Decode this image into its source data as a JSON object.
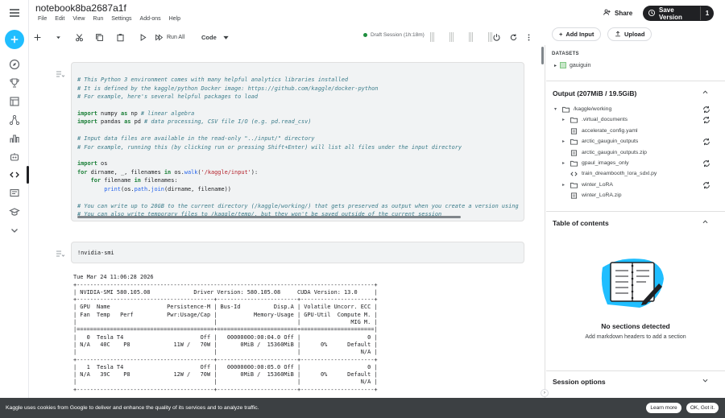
{
  "app": {
    "notebook_title": "notebook8ba2687a1f",
    "menu": [
      "File",
      "Edit",
      "View",
      "Run",
      "Settings",
      "Add-ons",
      "Help"
    ],
    "share_label": "Share",
    "save_label": "Save Version",
    "save_count": "1"
  },
  "rail": {
    "icons": [
      "menu-icon",
      "create-icon",
      "compass-icon",
      "trophy-icon",
      "table-icon",
      "models-icon",
      "chart-icon",
      "school-icon",
      "code-icon",
      "comments-icon",
      "learn-icon",
      "more-icon"
    ]
  },
  "toolbar": {
    "run_all_label": "Run All",
    "cell_type": "Code",
    "session_label": "Draft Session (1h:18m)"
  },
  "cells": {
    "code1": [
      "# This Python 3 environment comes with many helpful analytics libraries installed",
      "# It is defined by the kaggle/python Docker image: https://github.com/kaggle/docker-python",
      "# For example, here's several helpful packages to load",
      "",
      "import numpy as np # linear algebra",
      "import pandas as pd # data processing, CSV file I/O (e.g. pd.read_csv)",
      "",
      "# Input data files are available in the read-only \"../input/\" directory",
      "# For example, running this (by clicking run or pressing Shift+Enter) will list all files under the input directory",
      "",
      "import os",
      "for dirname, _, filenames in os.walk('/kaggle/input'):",
      "    for filename in filenames:",
      "        print(os.path.join(dirname, filename))",
      "",
      "# You can write up to 20GB to the current directory (/kaggle/working/) that gets preserved as output when you create a version using",
      "# You can also write temporary files to /kaggle/temp/, but they won't be saved outside of the current session"
    ],
    "code2": "!nvidia-smi",
    "output2": [
      "Tue Mar 24 11:06:28 2026",
      "+-----------------------------------------------------------------------------------------+",
      "| NVIDIA-SMI 580.105.08             Driver Version: 580.105.08     CUDA Version: 13.0     |",
      "+-----------------------------------------+------------------------+----------------------+",
      "| GPU  Name                 Persistence-M | Bus-Id          Disp.A | Volatile Uncorr. ECC |",
      "| Fan  Temp   Perf          Pwr:Usage/Cap |           Memory-Usage | GPU-Util  Compute M. |",
      "|                                         |                        |               MIG M. |",
      "|=========================================+========================+======================|",
      "|   0  Tesla T4                       Off |   00000000:00:04.0 Off |                    0 |",
      "| N/A   40C    P8             11W /   70W |       0MiB /  15360MiB |      0%      Default |",
      "|                                         |                        |                  N/A |",
      "+-----------------------------------------+------------------------+----------------------+",
      "|   1  Tesla T4                       Off |   00000000:00:05.0 Off |                    0 |",
      "| N/A   39C    P8             12W /   70W |       0MiB /  15360MiB |      0%      Default |",
      "|                                         |                        |                  N/A |",
      "+-----------------------------------------+------------------------+----------------------+"
    ]
  },
  "right_panel": {
    "add_input_label": "Add Input",
    "upload_label": "Upload",
    "datasets_label": "DATASETS",
    "dataset_name": "gauiguin",
    "output_title": "Output (207MiB / 19.5GiB)",
    "tree": [
      {
        "name": "/kaggle/working",
        "kind": "folder",
        "level": 0,
        "expanded": true,
        "sync": true
      },
      {
        "name": ".virtual_documents",
        "kind": "folder",
        "level": 1,
        "expanded": false,
        "sync": true
      },
      {
        "name": "accelerate_config.yaml",
        "kind": "file",
        "level": 1,
        "sync": false
      },
      {
        "name": "arctic_gauguin_outputs",
        "kind": "folder",
        "level": 1,
        "expanded": false,
        "sync": true
      },
      {
        "name": "arctic_gauguin_outputs.zip",
        "kind": "file",
        "level": 1,
        "sync": false
      },
      {
        "name": "gpaul_images_only",
        "kind": "folder",
        "level": 1,
        "expanded": false,
        "sync": true
      },
      {
        "name": "train_dreambooth_lora_sdxl.py",
        "kind": "code",
        "level": 1,
        "sync": false
      },
      {
        "name": "winter_LoRA",
        "kind": "folder",
        "level": 1,
        "expanded": false,
        "sync": true
      },
      {
        "name": "winter_LoRA.zip",
        "kind": "file",
        "level": 1,
        "sync": false
      }
    ],
    "toc_title": "Table of contents",
    "toc_empty_title": "No sections detected",
    "toc_empty_sub": "Add markdown headers to add a section",
    "session_options_title": "Session options"
  },
  "cookie": {
    "text": "Kaggle uses cookies from Google to deliver and enhance the quality of its services and to analyze traffic.",
    "learn_more": "Learn more",
    "ok": "OK, Got it."
  }
}
